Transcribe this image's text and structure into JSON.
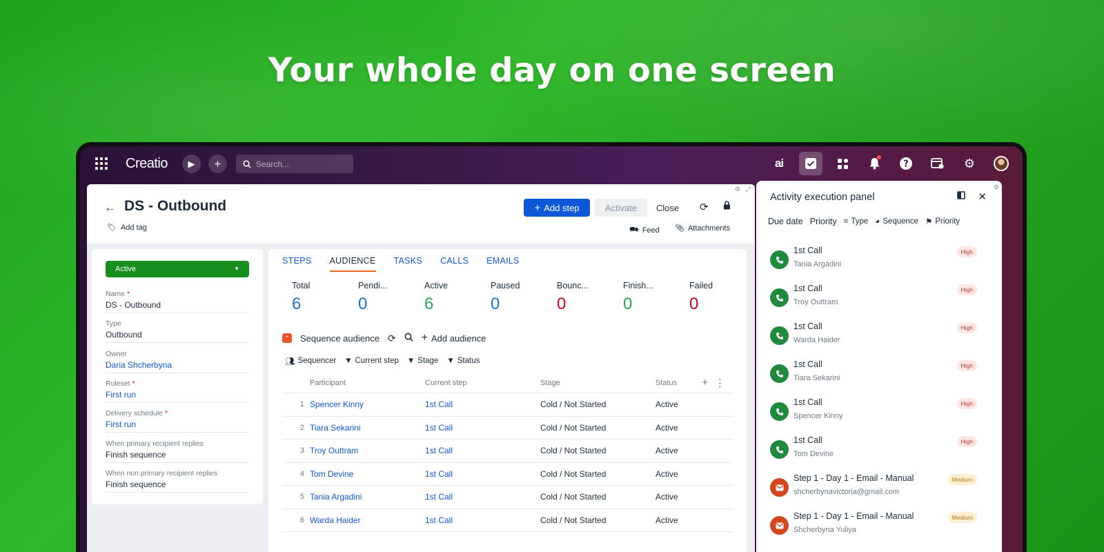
{
  "headline": "Your whole day on one screen",
  "topbar": {
    "logo": "Creatio",
    "search_placeholder": "Search...",
    "ai_label": "ai"
  },
  "record": {
    "title": "DS - Outbound",
    "add_tag": "Add tag",
    "buttons": {
      "add_step": "Add step",
      "activate": "Activate",
      "close": "Close"
    },
    "feed": "Feed",
    "attachments": "Attachments"
  },
  "details": {
    "status": "Active",
    "fields": [
      {
        "label": "Name",
        "required": "*",
        "value": "DS - Outbound",
        "link": false
      },
      {
        "label": "Type",
        "required": "",
        "value": "Outbound",
        "link": false
      },
      {
        "label": "Owner",
        "required": "",
        "value": "Daria Shcherbyna",
        "link": true
      },
      {
        "label": "Ruleset",
        "required": "*",
        "value": "First run",
        "link": true
      },
      {
        "label": "Delivery schedule",
        "required": "*",
        "value": "First run",
        "link": true
      },
      {
        "label": "When primary recipient replies",
        "required": "",
        "value": "Finish sequence",
        "link": false
      },
      {
        "label": "When non primary recipient replies",
        "required": "",
        "value": "Finish sequence",
        "link": false
      }
    ]
  },
  "tabs": [
    "STEPS",
    "AUDIENCE",
    "TASKS",
    "CALLS",
    "EMAILS"
  ],
  "selected_tab": 1,
  "stats": [
    {
      "label": "Total",
      "value": "6",
      "color": "#1c6fd1"
    },
    {
      "label": "Pendi...",
      "value": "0",
      "color": "#1c6fd1"
    },
    {
      "label": "Active",
      "value": "6",
      "color": "#23a45a"
    },
    {
      "label": "Paused",
      "value": "0",
      "color": "#1c6fd1"
    },
    {
      "label": "Bounc...",
      "value": "0",
      "color": "#d0021b"
    },
    {
      "label": "Finish...",
      "value": "0",
      "color": "#23a45a"
    },
    {
      "label": "Failed",
      "value": "0",
      "color": "#d0021b"
    }
  ],
  "audience": {
    "title": "Sequence audience",
    "add_audience": "Add audience",
    "filters": [
      "Sequencer",
      "Current step",
      "Stage",
      "Status"
    ],
    "columns": [
      "Participant",
      "Current step",
      "Stage",
      "Status"
    ],
    "rows": [
      {
        "num": "1",
        "participant": "Spencer Kinny",
        "step": "1st Call",
        "stage": "Cold / Not Started",
        "status": "Active"
      },
      {
        "num": "2",
        "participant": "Tiara Sekarini",
        "step": "1st Call",
        "stage": "Cold / Not Started",
        "status": "Active"
      },
      {
        "num": "3",
        "participant": "Troy Outtram",
        "step": "1st Call",
        "stage": "Cold / Not Started",
        "status": "Active"
      },
      {
        "num": "4",
        "participant": "Tom Devine",
        "step": "1st Call",
        "stage": "Cold / Not Started",
        "status": "Active"
      },
      {
        "num": "5",
        "participant": "Tania Argadini",
        "step": "1st Call",
        "stage": "Cold / Not Started",
        "status": "Active"
      },
      {
        "num": "6",
        "participant": "Warda Haider",
        "step": "1st Call",
        "stage": "Cold / Not Started",
        "status": "Active"
      }
    ]
  },
  "panel": {
    "title": "Activity execution panel",
    "sort": {
      "due_date": "Due date",
      "priority": "Priority",
      "type": "Type",
      "sequence": "Sequence",
      "priority_flag": "Priority"
    },
    "activities": [
      {
        "kind": "call",
        "title": "1st Call",
        "sub": "Tania Argadini",
        "badge": "High"
      },
      {
        "kind": "call",
        "title": "1st Call",
        "sub": "Troy Outtram",
        "badge": "High"
      },
      {
        "kind": "call",
        "title": "1st Call",
        "sub": "Warda Haider",
        "badge": "High"
      },
      {
        "kind": "call",
        "title": "1st Call",
        "sub": "Tiara Sekarini",
        "badge": "High"
      },
      {
        "kind": "call",
        "title": "1st Call",
        "sub": "Spencer Kinny",
        "badge": "High"
      },
      {
        "kind": "call",
        "title": "1st Call",
        "sub": "Tom Devine",
        "badge": "High"
      },
      {
        "kind": "mail",
        "title": "Step 1 - Day 1 - Email - Manual",
        "sub": "shcherbynavictoria@gmail.com",
        "badge": "Medium"
      },
      {
        "kind": "mail",
        "title": "Step 1 - Day 1 - Email - Manual",
        "sub": "Shcherbyna Yuliya",
        "badge": "Medium"
      }
    ]
  }
}
